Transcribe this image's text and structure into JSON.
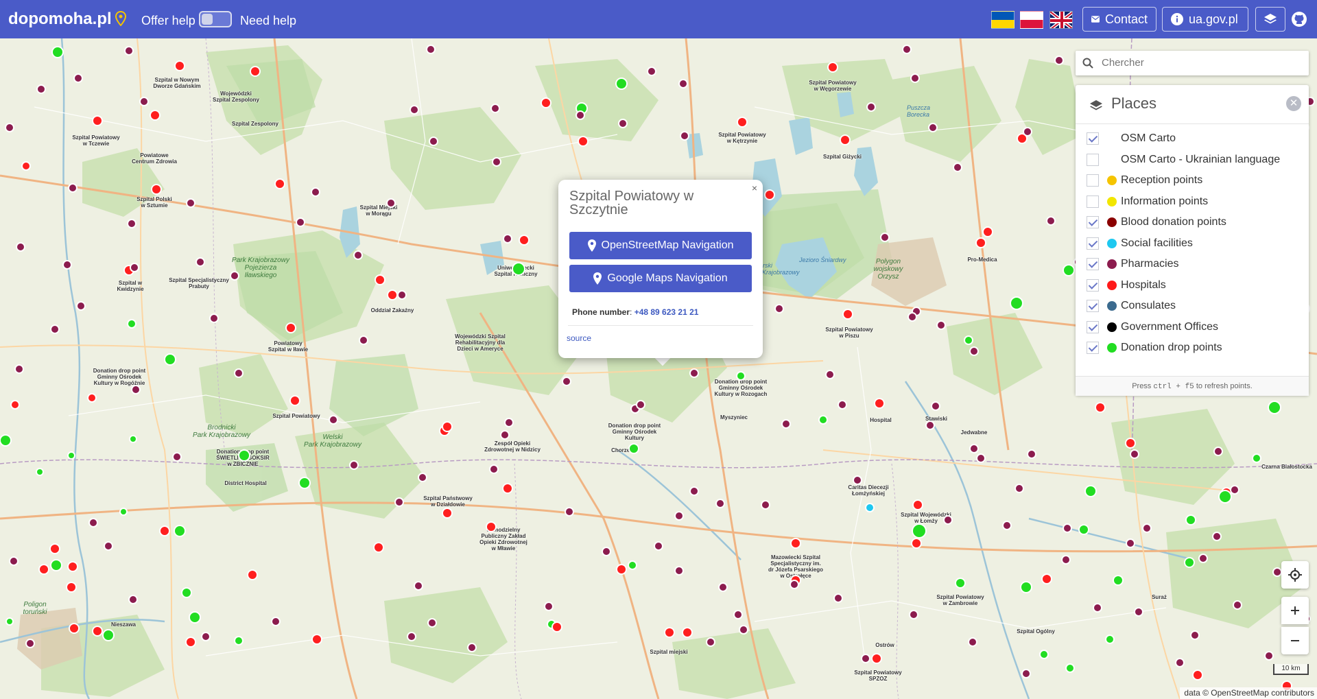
{
  "header": {
    "brand": "dopomoha.pl",
    "offer_help": "Offer help",
    "need_help": "Need help",
    "contact": "Contact",
    "gov": "ua.gov.pl",
    "flags": [
      "ua-flag",
      "pl-flag",
      "gb-flag"
    ]
  },
  "search": {
    "placeholder": "Chercher"
  },
  "panel": {
    "title": "Places",
    "footer_prefix": "Press ",
    "footer_keys": "ctrl + f5",
    "footer_suffix": " to refresh points.",
    "layers": [
      {
        "label": "OSM Carto",
        "checked": true,
        "color": ""
      },
      {
        "label": "OSM Carto - Ukrainian language",
        "checked": false,
        "color": ""
      },
      {
        "label": "Reception points",
        "checked": false,
        "color": "#f5c400"
      },
      {
        "label": "Information points",
        "checked": false,
        "color": "#f2e600"
      },
      {
        "label": "Blood donation points",
        "checked": true,
        "color": "#8b0000"
      },
      {
        "label": "Social facilities",
        "checked": true,
        "color": "#1ec8f0"
      },
      {
        "label": "Pharmacies",
        "checked": true,
        "color": "#8c1c4e"
      },
      {
        "label": "Hospitals",
        "checked": true,
        "color": "#ff1a1a"
      },
      {
        "label": "Consulates",
        "checked": true,
        "color": "#3b6a8e"
      },
      {
        "label": "Government Offices",
        "checked": true,
        "color": "#000000"
      },
      {
        "label": "Donation drop points",
        "checked": true,
        "color": "#22dd22"
      }
    ]
  },
  "popup": {
    "title": "Szpital Powiatowy w Szczytnie",
    "osm_nav": "OpenStreetMap Navigation",
    "google_nav": "Google Maps Navigation",
    "phone_label": "Phone number",
    "phone": "+48 89 623 21 21",
    "source": "source"
  },
  "map": {
    "scale": "10 km",
    "attribution": "data © OpenStreetMap contributors",
    "labels": [
      "Szpital w Nowym\nDworze Gdańskim",
      "Wojewódzki\nSzpital Zespolony",
      "Szpital Powiatowy\nw Tczewie",
      "Powiatowe\nCentrum Zdrowia",
      "Szpital Polski\nw Sztumie",
      "Szpital Specjalistyczny\nPrabuty",
      "Szpital w\nKwidzynie",
      "Powiatowy\nSzpital w Iławie",
      "Oddział Zakaźny",
      "Wojewódzki Szpital\nRehabilitacyjny dla\nDzieci w Ameryce",
      "Uniwersytecki\nSzpital Kliniczny",
      "Szpital Miejski\nw Morągu",
      "Szpital Powiatowy\nw Kętrzynie",
      "Szpital Giżycki",
      "Szpital Powiatowy\nw Węgorzewie",
      "Szpital Powiatowy\nw Piszu",
      "Szpital Powiatowy",
      "Zespół Opieki\nZdrowotnej w Nidzicy",
      "Szpital Państwowy\nw Działdowie",
      "District Hospital",
      "Samodzielny\nPubliczny Zakład\nOpieki Zdrowotnej\nw Mławie",
      "Mazowiecki Szpital\nSpecjalistyczny im.\ndr Józefa Psarskiego\nw Ostrołęce",
      "Szpital Wojewódzki\nw Łomży",
      "Szpital Powiatowy\nw Zambrowie",
      "Szpital Ogólny",
      "Szpital miejski",
      "Szpital Powiatowy\nSPZOZ",
      "Hospital",
      "Pro-Medica",
      "Caritas Diecezji\nŁomżyńskiej",
      "Donation drop point\nGminny Ośrodek\nKultury w Rozogach",
      "Donation drop point\nGminny Ośrodek\nKultury",
      "Donation drop point\nGminny Ośrodek\nKultury w Rogóźnie",
      "Donation drop point\nŚWIETLICA GOKSIR\nw ZBICZNIE",
      "Szpital Zespolony",
      "Jedwabne",
      "Stawiski",
      "Chorzele",
      "Myszyniec",
      "Nieszawa",
      "Ostrów",
      "Suraż",
      "Czarna Białostocka"
    ],
    "water": [
      "Jezioro Śniardwy",
      "Mazurski\nPark Krajobrazowy",
      "Puszcza\nBorecka"
    ],
    "parks": [
      "Park Krajobrazowy\nPojezierza\nIławskiego",
      "Welski\nPark Krajobrazowy",
      "Brodnicki\nPark Krajobrazowy",
      "Polygon\nwojskowy\nOrzysz",
      "Poligon\ntoruński"
    ]
  }
}
